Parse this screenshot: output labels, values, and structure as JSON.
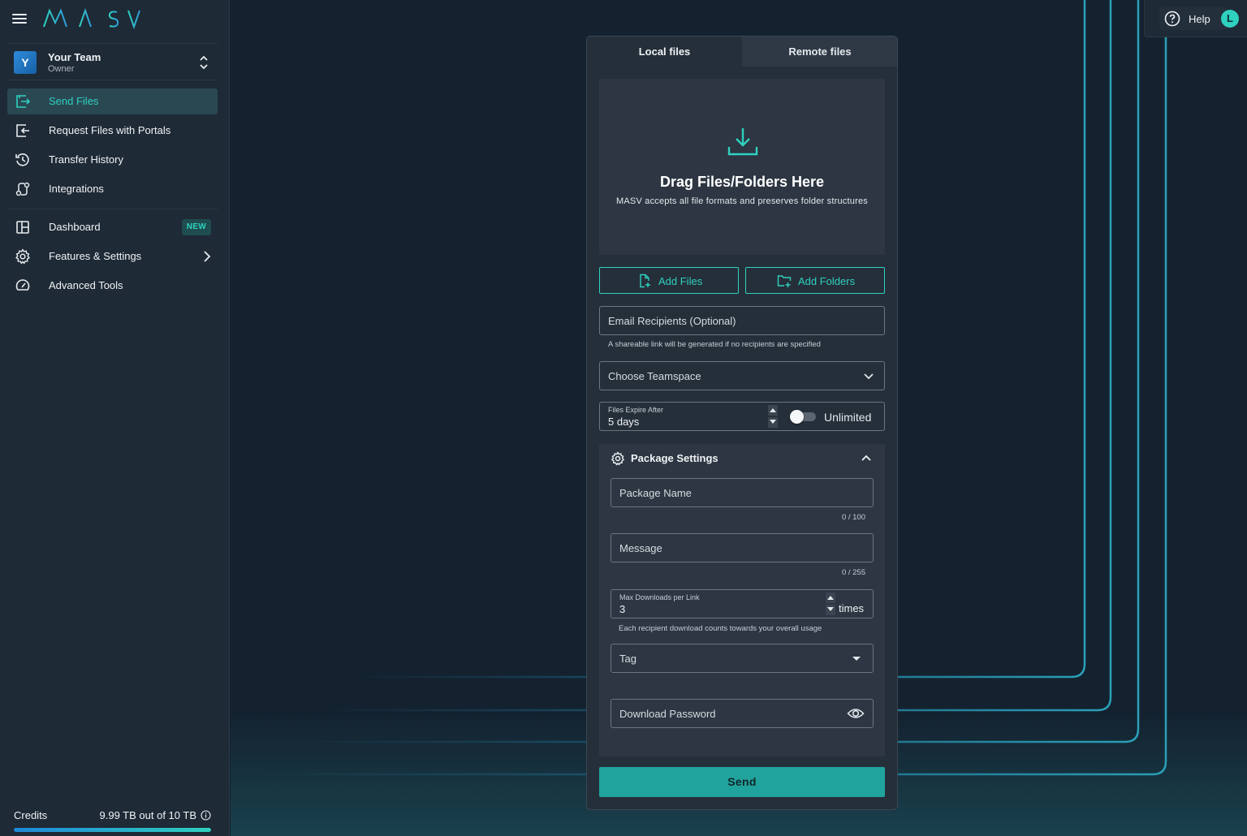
{
  "app": {
    "logo_text": "MASV"
  },
  "team": {
    "avatar_letter": "Y",
    "name": "Your Team",
    "role": "Owner"
  },
  "sidebar": {
    "items": [
      {
        "label": "Send Files",
        "icon": "send-files-icon",
        "active": true
      },
      {
        "label": "Request Files with Portals",
        "icon": "request-files-icon"
      },
      {
        "label": "Transfer History",
        "icon": "history-icon"
      },
      {
        "label": "Integrations",
        "icon": "integrations-icon"
      },
      {
        "label": "Dashboard",
        "icon": "dashboard-icon",
        "badge": "NEW"
      },
      {
        "label": "Features & Settings",
        "icon": "gear-icon"
      },
      {
        "label": "Advanced Tools",
        "icon": "gauge-icon"
      }
    ]
  },
  "credits": {
    "label": "Credits",
    "value": "9.99 TB out of 10 TB",
    "used_fraction": 0.999
  },
  "help": {
    "label": "Help",
    "user_initial": "L"
  },
  "tabs": [
    {
      "label": "Local files",
      "active": true
    },
    {
      "label": "Remote files",
      "active": false
    }
  ],
  "dropzone": {
    "title": "Drag Files/Folders Here",
    "subtitle": "MASV accepts all file formats and preserves folder structures"
  },
  "buttons": {
    "add_files": "Add Files",
    "add_folders": "Add Folders",
    "send": "Send"
  },
  "form": {
    "email_placeholder": "Email Recipients (Optional)",
    "email_hint": "A shareable link will be generated if no recipients are specified",
    "teamspace_placeholder": "Choose Teamspace",
    "expire_label": "Files Expire After",
    "expire_value": "5 days",
    "unlimited_label": "Unlimited",
    "unlimited_on": false
  },
  "package": {
    "title": "Package Settings",
    "name_placeholder": "Package Name",
    "name_counter": "0 / 100",
    "message_placeholder": "Message",
    "message_counter": "0 / 255",
    "max_downloads_label": "Max Downloads per Link",
    "max_downloads_value": "3",
    "max_downloads_unit": "times",
    "max_downloads_hint": "Each recipient download counts towards your overall usage",
    "tag_placeholder": "Tag",
    "password_placeholder": "Download Password"
  },
  "colors": {
    "accent": "#2fd1bf",
    "send_button": "#21a39d",
    "sidebar_bg": "#1e2a36",
    "page_bg": "#142230"
  }
}
